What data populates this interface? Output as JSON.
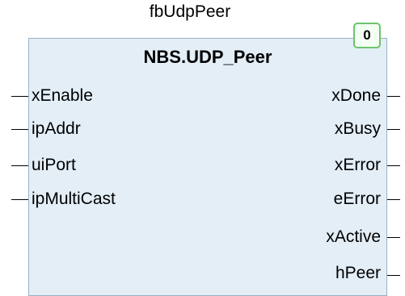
{
  "block": {
    "instance_name": "fbUdpPeer",
    "type_name": "NBS.UDP_Peer",
    "order_badge": "0",
    "inputs": [
      "xEnable",
      "ipAddr",
      "uiPort",
      "ipMultiCast"
    ],
    "outputs": [
      "xDone",
      "xBusy",
      "xError",
      "eError",
      "xActive",
      "hPeer"
    ]
  }
}
